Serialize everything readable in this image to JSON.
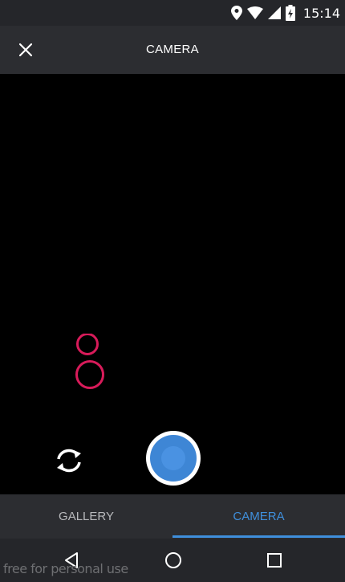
{
  "status_bar": {
    "time": "15:14",
    "icons": [
      "location-icon",
      "wifi-icon",
      "signal-icon",
      "battery-charging-icon"
    ]
  },
  "app_bar": {
    "title": "CAMERA",
    "close_icon": "close-icon"
  },
  "viewfinder": {
    "switch_camera_icon": "switch-camera-icon",
    "shutter_color": "#3e86d5",
    "reticle_color": "#d81b5a"
  },
  "tabs": [
    {
      "label": "GALLERY",
      "active": false
    },
    {
      "label": "CAMERA",
      "active": true
    }
  ],
  "accent_color": "#3f8fdc",
  "nav_bar": {
    "icons": [
      "back-icon",
      "home-icon",
      "recents-icon"
    ]
  },
  "watermark": "free for personal use"
}
